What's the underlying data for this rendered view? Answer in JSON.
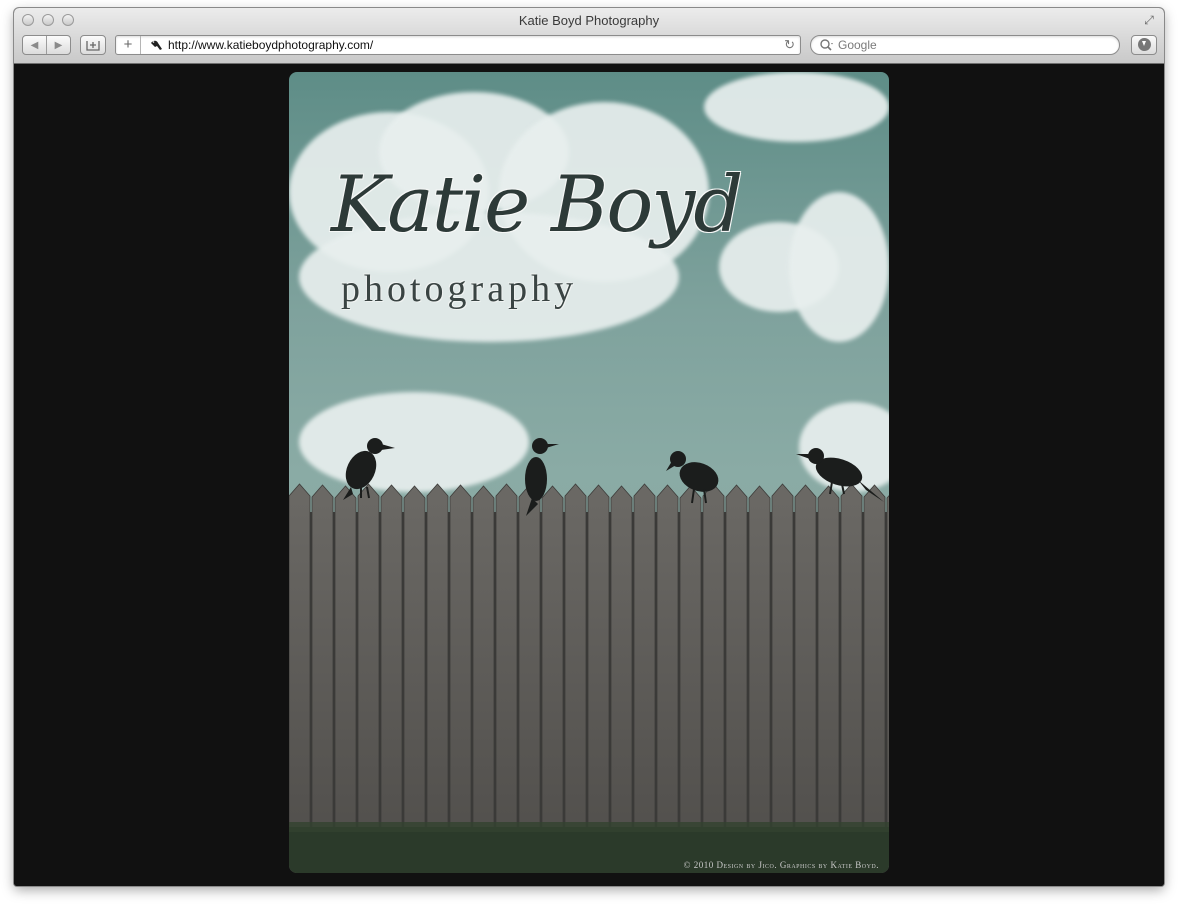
{
  "window": {
    "title": "Katie Boyd Photography"
  },
  "toolbar": {
    "url": "http://www.katieboydphotography.com/",
    "search_placeholder": "Google"
  },
  "page": {
    "logo_script": "Katie Boyd",
    "logo_subtitle": "photography",
    "footer_credit": "© 2010 Design by Jico. Graphics by Katie Boyd."
  },
  "colors": {
    "sky": "#6f9893",
    "fence": "#5d5b58",
    "page_background": "#111111",
    "grass": "#2b3a2a"
  },
  "icons": {
    "back": "back-arrow-icon",
    "forward": "forward-arrow-icon",
    "bookmark": "add-bookmark-icon",
    "plus": "plus-icon",
    "reload": "reload-icon",
    "search": "search-icon",
    "download": "download-icon",
    "fullscreen": "fullscreen-icon",
    "favicon": "crow-favicon-icon"
  }
}
